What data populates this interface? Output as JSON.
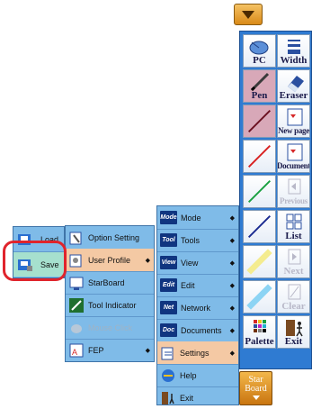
{
  "toolbar": {
    "buttons": [
      {
        "label": "PC",
        "icon": "mouse-icon"
      },
      {
        "label": "Width",
        "icon": "line-width-icon"
      },
      {
        "label": "Pen",
        "icon": "pen-icon"
      },
      {
        "label": "Eraser",
        "icon": "eraser-icon"
      },
      {
        "label": "",
        "icon": "pen-color-dark-red-icon"
      },
      {
        "label": "New page",
        "icon": "new-page-icon"
      },
      {
        "label": "",
        "icon": "pen-color-red-icon"
      },
      {
        "label": "Document",
        "icon": "document-icon"
      },
      {
        "label": "",
        "icon": "pen-color-green-icon"
      },
      {
        "label": "Previous",
        "icon": "previous-icon"
      },
      {
        "label": "",
        "icon": "pen-color-blue-icon"
      },
      {
        "label": "List",
        "icon": "list-icon"
      },
      {
        "label": "",
        "icon": "highlighter-yellow-icon"
      },
      {
        "label": "Next",
        "icon": "next-icon"
      },
      {
        "label": "",
        "icon": "highlighter-cyan-icon"
      },
      {
        "label": "Clear",
        "icon": "clear-icon"
      },
      {
        "label": "Palette",
        "icon": "palette-icon"
      },
      {
        "label": "Exit",
        "icon": "exit-icon"
      }
    ],
    "starboard_line1": "Star",
    "starboard_line2": "Board"
  },
  "main_menu": {
    "items": [
      {
        "icon_text": "Mode",
        "label": "Mode"
      },
      {
        "icon_text": "Tool",
        "label": "Tools"
      },
      {
        "icon_text": "View",
        "label": "View"
      },
      {
        "icon_text": "Edit",
        "label": "Edit"
      },
      {
        "icon_text": "Net",
        "label": "Network"
      },
      {
        "icon_text": "Doc",
        "label": "Documents"
      },
      {
        "icon_text": "",
        "label": "Settings"
      },
      {
        "icon_text": "",
        "label": "Help"
      },
      {
        "icon_text": "",
        "label": "Exit"
      }
    ],
    "arrow": "◆"
  },
  "settings_menu": {
    "items": [
      {
        "label": "Option Setting"
      },
      {
        "label": "User Profile"
      },
      {
        "label": "StarBoard"
      },
      {
        "label": "Tool Indicator"
      },
      {
        "label": "Mouse Click"
      },
      {
        "label": "FEP"
      }
    ]
  },
  "user_profile_menu": {
    "items": [
      {
        "label": "Load"
      },
      {
        "label": "Save"
      }
    ]
  },
  "colors": {
    "panel_blue": "#2f7bd2",
    "menu_bg": "#7fbbe8",
    "menu_highlight": "#f4c9a4",
    "save_highlight": "#a6e0ce",
    "annotation_red": "#e0242c"
  }
}
